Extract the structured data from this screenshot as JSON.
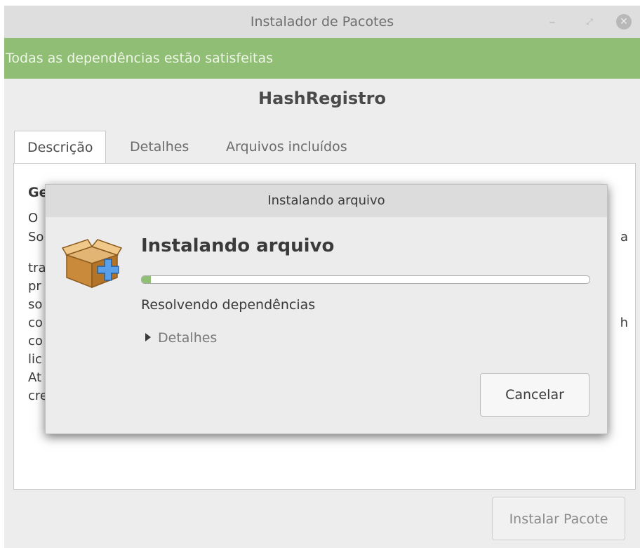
{
  "window": {
    "title": "Instalador de Pacotes",
    "controls": {
      "minimize": "–",
      "maximize": "⤢",
      "close": "✕"
    }
  },
  "banner": {
    "text": "Todas as dependências estão satisfeitas",
    "color": "#8fbe74"
  },
  "package": {
    "name": "HashRegistro"
  },
  "tabs": [
    {
      "label": "Descrição",
      "active": true
    },
    {
      "label": "Detalhes",
      "active": false
    },
    {
      "label": "Arquivos incluídos",
      "active": false
    }
  ],
  "description": {
    "title_partial": "Ge",
    "lines": [
      "O",
      "So",
      "",
      "tra",
      "pr",
      "so",
      "co",
      "co",
      "lic",
      "At",
      "cre"
    ],
    "right_fragments": [
      "a",
      "h"
    ]
  },
  "install_button": {
    "label": "Instalar Pacote"
  },
  "dialog": {
    "title": "Instalando arquivo",
    "icon": "package-install-icon",
    "heading": "Instalando arquivo",
    "progress": 0.02,
    "status": "Resolvendo dependências",
    "details_label": "Detalhes",
    "cancel_label": "Cancelar"
  }
}
